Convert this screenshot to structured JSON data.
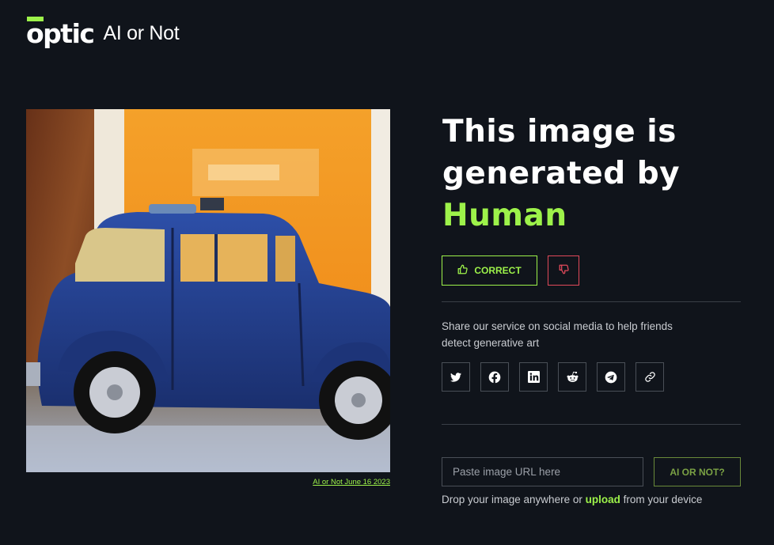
{
  "header": {
    "logo_text": "optic",
    "product_name": "AI or Not"
  },
  "image": {
    "description_icon": "blue-vintage-car-photo",
    "caption": "AI or Not June 16 2023"
  },
  "result": {
    "line1": "This image is",
    "line2": "generated by",
    "verdict": "Human"
  },
  "feedback": {
    "correct_label": "CORRECT",
    "correct_icon": "thumbs-up-icon",
    "wrong_icon": "thumbs-down-icon"
  },
  "share": {
    "text": "Share our service on social media to help friends detect generative art",
    "items": [
      "twitter-icon",
      "facebook-icon",
      "linkedin-icon",
      "reddit-icon",
      "telegram-icon",
      "link-icon"
    ]
  },
  "check": {
    "placeholder": "Paste image URL here",
    "button_label": "AI OR NOT?",
    "drop_prefix": "Drop your image anywhere or ",
    "upload_label": "upload",
    "drop_suffix": " from your device"
  },
  "colors": {
    "background": "#10141b",
    "accent": "#9df24a",
    "danger": "#e0495a"
  }
}
